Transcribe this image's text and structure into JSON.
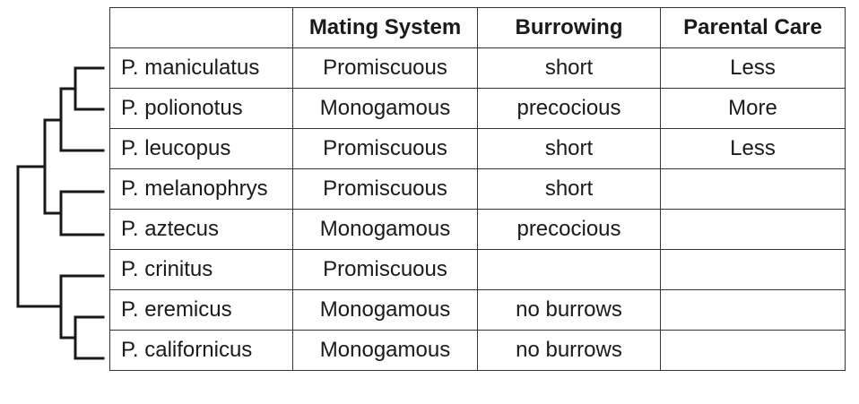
{
  "columns": [
    "",
    "Mating System",
    "Burrowing",
    "Parental Care"
  ],
  "rows": [
    {
      "species": "P. maniculatus",
      "mating": "Promiscuous",
      "burrowing": "short",
      "care": "Less"
    },
    {
      "species": "P. polionotus",
      "mating": "Monogamous",
      "burrowing": "precocious",
      "care": "More"
    },
    {
      "species": "P. leucopus",
      "mating": "Promiscuous",
      "burrowing": "short",
      "care": "Less"
    },
    {
      "species": "P. melanophrys",
      "mating": "Promiscuous",
      "burrowing": "short",
      "care": ""
    },
    {
      "species": "P. aztecus",
      "mating": "Monogamous",
      "burrowing": "precocious",
      "care": ""
    },
    {
      "species": "P. crinitus",
      "mating": "Promiscuous",
      "burrowing": "",
      "care": ""
    },
    {
      "species": "P. eremicus",
      "mating": "Monogamous",
      "burrowing": "no burrows",
      "care": ""
    },
    {
      "species": "P. californicus",
      "mating": "Monogamous",
      "burrowing": "no burrows",
      "care": ""
    }
  ],
  "colors": {
    "line": "#1a1a1a",
    "border": "#333333",
    "background": "#ffffff"
  }
}
